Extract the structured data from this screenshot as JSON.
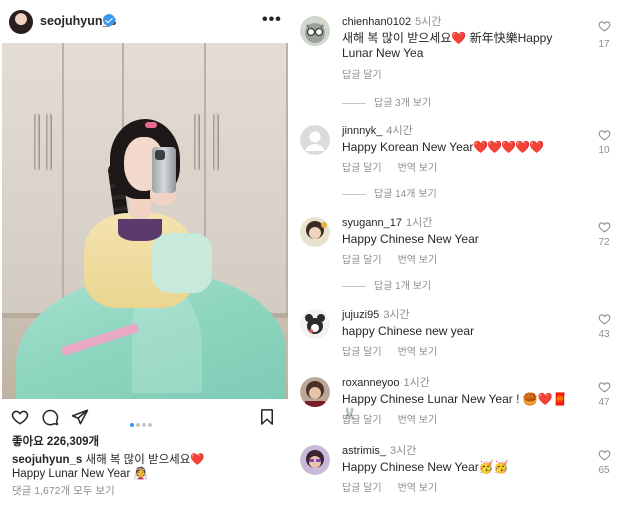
{
  "post": {
    "username": "seojuhyun_s",
    "likes_label": "좋아요 226,309개",
    "caption_username": "seojuhyun_s",
    "caption_text": "새해 복 많이 받으세요",
    "caption_heart": "❤️",
    "caption_line2": "Happy Lunar New Year",
    "caption_line2_emoji": "👰",
    "view_comments": "댓글 1,672개 모두 보기",
    "carousel_dots": 4,
    "carousel_active_index": 0,
    "colors": {
      "accent": "#3897f0",
      "heart": "#ed4956",
      "muted": "#8e8e8e",
      "text": "#262626"
    }
  },
  "comments": [
    {
      "username": "chienhan0102",
      "time": "5시간",
      "text": "새해 복 많이 받으세요❤️ 新年快樂Happy Lunar New Yea",
      "reply_label": "답글 달기",
      "translate_label": "",
      "likes": "17",
      "view_replies": "답글 3개 보기",
      "avatar_icon": "cat-with-glasses-avatar"
    },
    {
      "username": "jinnnyk_",
      "time": "4시간",
      "text": "Happy Korean New Year",
      "hearts": "❤️❤️❤️❤️❤️",
      "reply_label": "답글 달기",
      "translate_label": "번역 보기",
      "likes": "10",
      "view_replies": "답글 14개 보기",
      "avatar_icon": "default-avatar"
    },
    {
      "username": "syugann_17",
      "time": "1시간",
      "text": "Happy Chinese New Year",
      "reply_label": "답글 달기",
      "translate_label": "번역 보기",
      "likes": "72",
      "view_replies": "답글 1개 보기",
      "avatar_icon": "girl-avatar"
    },
    {
      "username": "jujuzi95",
      "time": "3시간",
      "text": "happy Chinese new year",
      "reply_label": "답글 달기",
      "translate_label": "번역 보기",
      "likes": "43",
      "view_replies": "",
      "avatar_icon": "cartoon-bear-avatar"
    },
    {
      "username": "roxanneyoo",
      "time": "1시간",
      "text": "Happy Chinese Lunar New Year !",
      "emojis": "🥮❤️🧧🐰",
      "reply_label": "답글 달기",
      "translate_label": "번역 보기",
      "likes": "47",
      "view_replies": "",
      "avatar_icon": "woman-avatar"
    },
    {
      "username": "astrimis_",
      "time": "3시간",
      "text": "Happy Chinese New Year",
      "emojis": "🥳🥳",
      "reply_label": "답글 달기",
      "translate_label": "번역 보기",
      "likes": "65",
      "view_replies": "",
      "avatar_icon": "woman-sunglasses-avatar"
    }
  ]
}
